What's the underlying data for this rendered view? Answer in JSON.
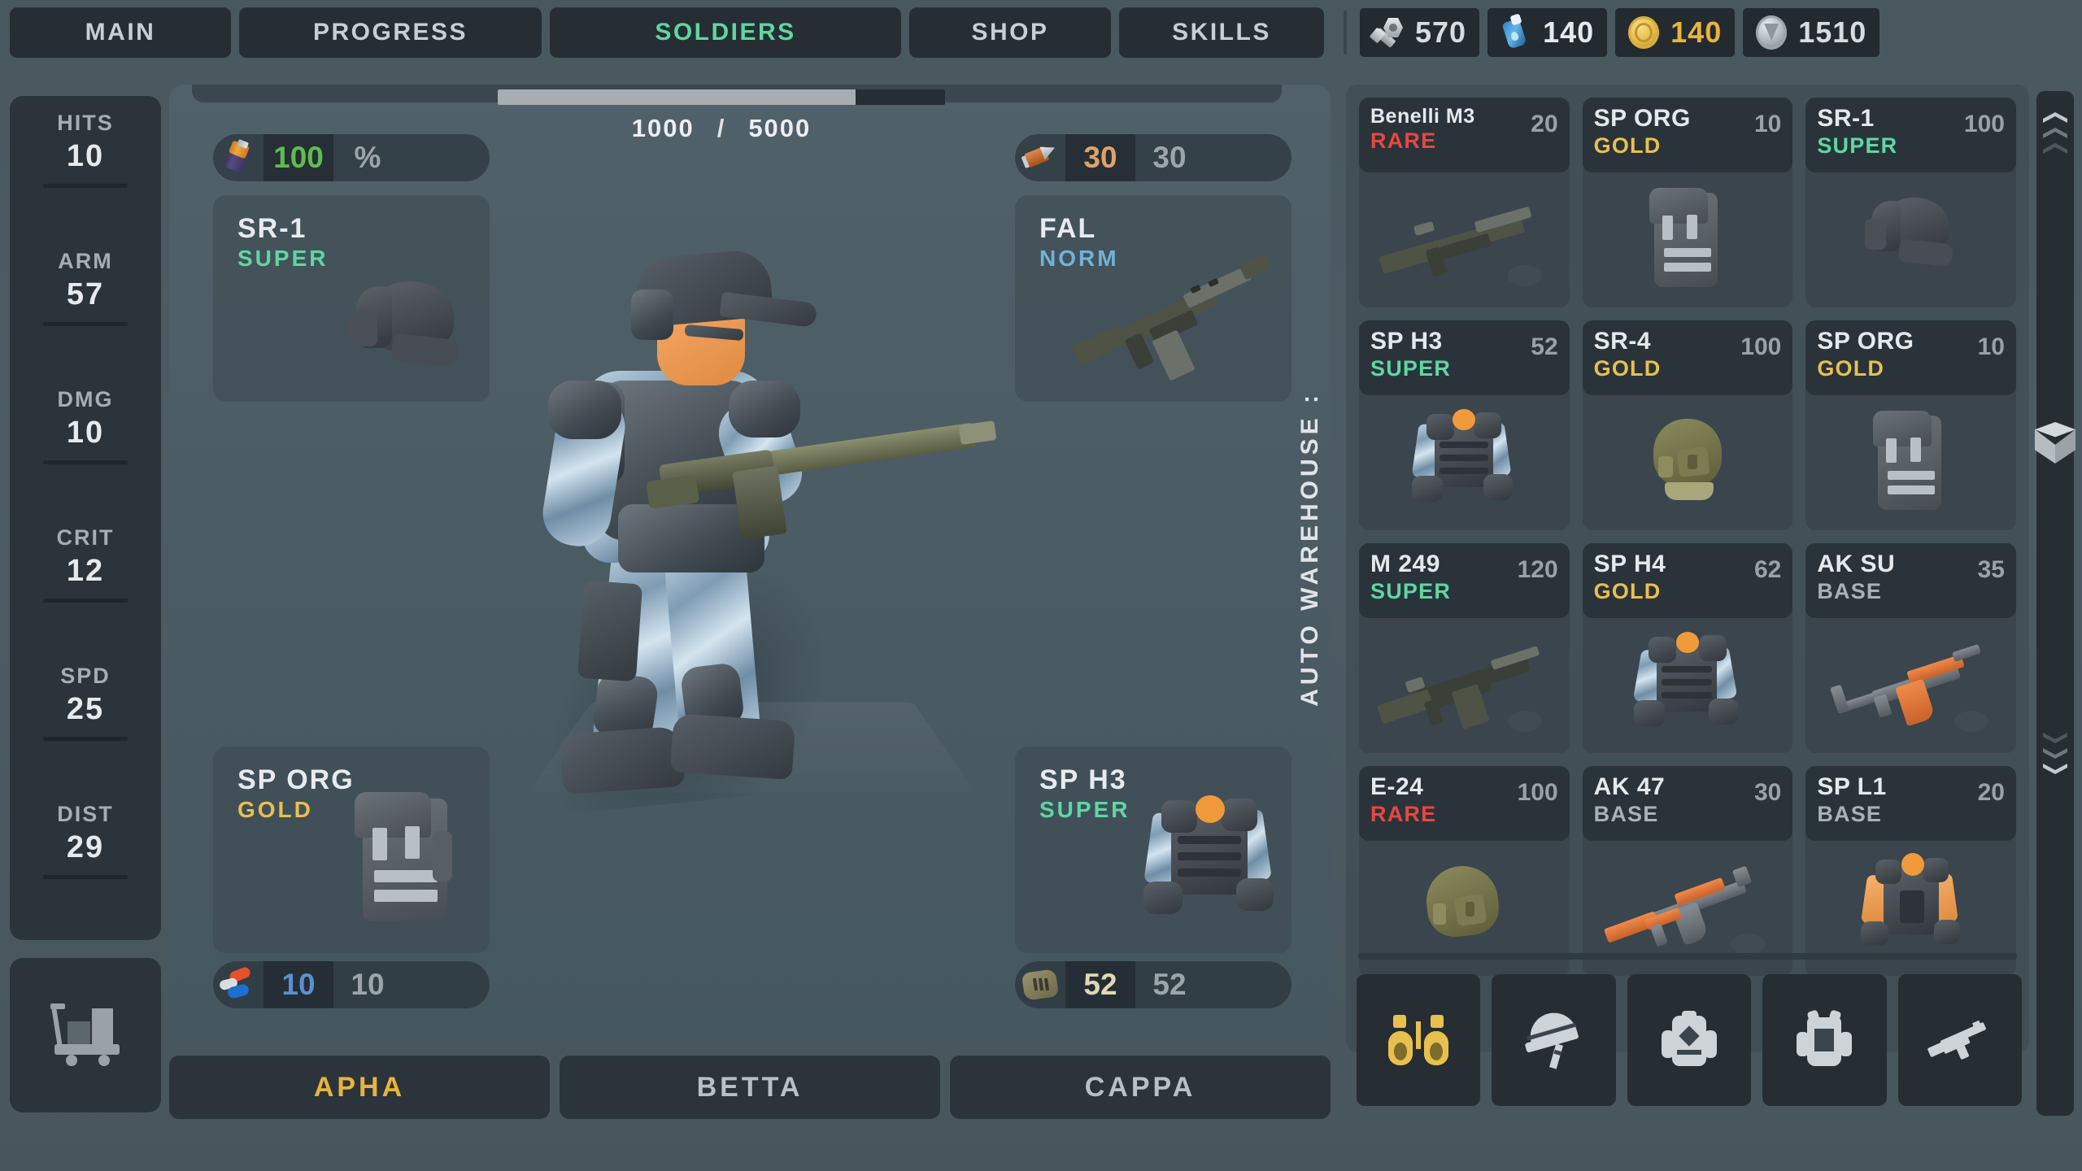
{
  "topbar": {
    "tabs": [
      {
        "label": "MAIN",
        "active": false
      },
      {
        "label": "PROGRESS",
        "active": false
      },
      {
        "label": "SOLDIERS",
        "active": true
      },
      {
        "label": "SHOP",
        "active": false
      },
      {
        "label": "SKILLS",
        "active": false
      }
    ],
    "currencies": [
      {
        "icon": "bolt-nut-icon",
        "value": "570",
        "color": "#d8dcdf"
      },
      {
        "icon": "blue-flask-icon",
        "value": "140",
        "color": "#e7eaec"
      },
      {
        "icon": "gold-coin-icon",
        "value": "140",
        "color": "#e8b43a"
      },
      {
        "icon": "silver-gem-icon",
        "value": "1510",
        "color": "#d8dcdf"
      }
    ]
  },
  "stats": {
    "items": [
      {
        "label": "HITS",
        "value": "10"
      },
      {
        "label": "ARM",
        "value": "57"
      },
      {
        "label": "DMG",
        "value": "10"
      },
      {
        "label": "CRIT",
        "value": "12"
      },
      {
        "label": "SPD",
        "value": "25"
      },
      {
        "label": "DIST",
        "value": "29"
      }
    ]
  },
  "xp": {
    "current": "1000",
    "separator": "/",
    "max": "5000",
    "percent": 80
  },
  "equipment": {
    "helmet": {
      "name": "SR-1",
      "tier": "SUPER",
      "tier_class": "t-super",
      "meter_icon": "battery-icon",
      "meter_current": "100",
      "meter_max": "%",
      "meter_color": "#5fbd4e"
    },
    "weapon": {
      "name": "FAL",
      "tier": "NORM",
      "tier_class": "t-norm",
      "meter_icon": "bullet-icon",
      "meter_current": "30",
      "meter_max": "30",
      "meter_color": "#e0a26a"
    },
    "backpack": {
      "name": "SP ORG",
      "tier": "GOLD",
      "tier_class": "t-gold",
      "meter_icon": "pills-icon",
      "meter_current": "10",
      "meter_max": "10",
      "meter_color": "#5b8fd0"
    },
    "vest": {
      "name": "SP H3",
      "tier": "SUPER",
      "tier_class": "t-super",
      "meter_icon": "armor-plate-icon",
      "meter_current": "52",
      "meter_max": "52",
      "meter_color": "#ded8b4"
    }
  },
  "warehouse": {
    "label": "AUTO WAREHOUSE :",
    "items": [
      {
        "name": "Benelli M3",
        "tier": "RARE",
        "tier_class": "t-rare",
        "qty": "20",
        "art": "shotgun",
        "small": true
      },
      {
        "name": "SP ORG",
        "tier": "GOLD",
        "tier_class": "t-gold",
        "qty": "10",
        "art": "backpack",
        "small": false
      },
      {
        "name": "SR-1",
        "tier": "SUPER",
        "tier_class": "t-super",
        "qty": "100",
        "art": "helmet-dark",
        "small": false
      },
      {
        "name": "SP H3",
        "tier": "SUPER",
        "tier_class": "t-super",
        "qty": "52",
        "art": "vest-camo",
        "small": false
      },
      {
        "name": "SR-4",
        "tier": "GOLD",
        "tier_class": "t-gold",
        "qty": "100",
        "art": "helmet-olive",
        "small": false
      },
      {
        "name": "SP ORG",
        "tier": "GOLD",
        "tier_class": "t-gold",
        "qty": "10",
        "art": "backpack",
        "small": false
      },
      {
        "name": "M 249",
        "tier": "SUPER",
        "tier_class": "t-super",
        "qty": "120",
        "art": "lmg",
        "small": false
      },
      {
        "name": "SP H4",
        "tier": "GOLD",
        "tier_class": "t-gold",
        "qty": "62",
        "art": "vest-camo2",
        "small": false
      },
      {
        "name": "AK SU",
        "tier": "BASE",
        "tier_class": "t-base",
        "qty": "35",
        "art": "aksu",
        "small": false
      },
      {
        "name": "E-24",
        "tier": "RARE",
        "tier_class": "t-rare",
        "qty": "100",
        "art": "helmet-olive2",
        "small": false
      },
      {
        "name": "AK 47",
        "tier": "BASE",
        "tier_class": "t-base",
        "qty": "30",
        "art": "ak47",
        "small": false
      },
      {
        "name": "SP L1",
        "tier": "BASE",
        "tier_class": "t-base",
        "qty": "20",
        "art": "vest-tan",
        "small": false
      }
    ]
  },
  "filters": [
    {
      "icon": "binoculars-icon",
      "active": true
    },
    {
      "icon": "helmet-icon",
      "active": false
    },
    {
      "icon": "backpack-icon",
      "active": false
    },
    {
      "icon": "vest-icon",
      "active": false
    },
    {
      "icon": "rifle-icon",
      "active": false
    }
  ],
  "scroll": {
    "up_icon": "chevron-up-icon",
    "cube_icon": "cube-icon",
    "down_icon": "chevron-down-icon"
  },
  "squads": [
    {
      "label": "APHA",
      "active": true
    },
    {
      "label": "BETTA",
      "active": false
    },
    {
      "label": "CAPPA",
      "active": false
    }
  ],
  "colors": {
    "accent_green": "#5fd6a4",
    "accent_gold": "#e8b43a",
    "rare_red": "#e8473f",
    "panel": "#2b343b",
    "stage": "#4d5c64"
  }
}
